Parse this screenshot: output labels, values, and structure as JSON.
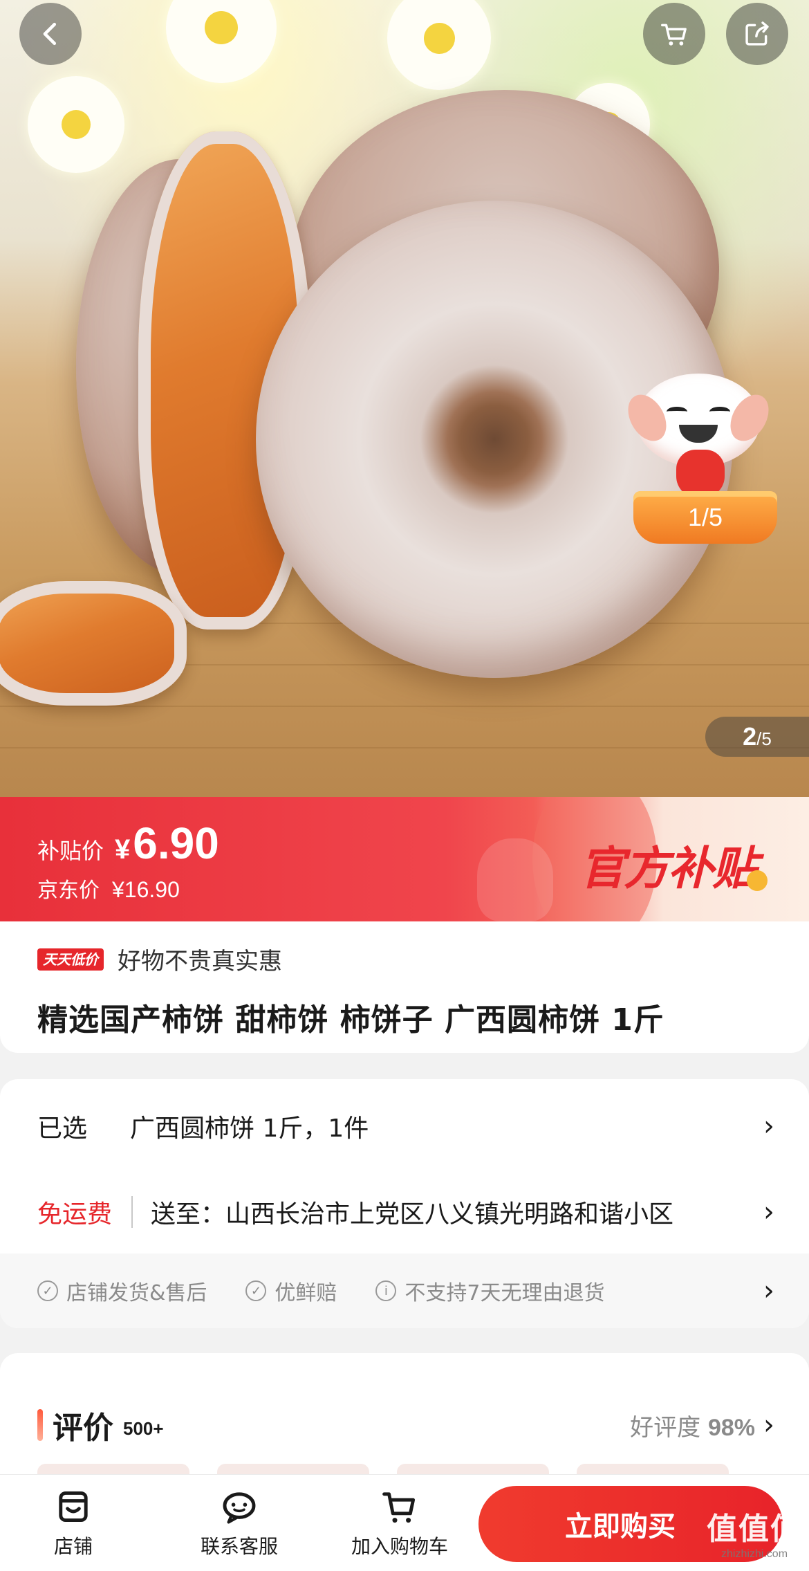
{
  "hero": {
    "pager_current": "2",
    "pager_total": "/5",
    "mascot_badge": "1/5"
  },
  "price": {
    "subsidy_label": "补贴价",
    "subsidy_currency": "¥",
    "subsidy_value": "6.90",
    "jd_label": "京东价",
    "jd_value": "¥16.90",
    "official_badge": "官方补贴"
  },
  "product": {
    "tag": "天天低价",
    "slogan": "好物不贵真实惠",
    "title": "精选国产柿饼 甜柿饼 柿饼子 广西圆柿饼 1斤"
  },
  "spec": {
    "selected_key": "已选",
    "selected_value": "广西圆柿饼 1斤，1件",
    "shipping_free": "免运费",
    "ship_to": "送至：山西长治市上党区八义镇光明路和谐小区",
    "chevron": "›"
  },
  "services": [
    {
      "icon": "check-circle-icon",
      "glyph": "✓",
      "label": "店铺发货&售后"
    },
    {
      "icon": "check-circle-icon",
      "glyph": "✓",
      "label": "优鲜赔"
    },
    {
      "icon": "info-circle-icon",
      "glyph": "i",
      "label": "不支持7天无理由退货"
    }
  ],
  "reviews": {
    "title": "评价",
    "count": "500+",
    "rate_label": "好评度",
    "rate_value": "98%"
  },
  "bottom_bar": {
    "shop": "店铺",
    "service": "联系客服",
    "add_cart": "加入购物车",
    "buy_now": "立即购买"
  },
  "watermark": {
    "big": "值值值",
    "small": "zhizhizhi.com"
  },
  "colors": {
    "brand_red": "#e6262b",
    "price_banner": "#f0454c",
    "muted_text": "#8a8a8a"
  }
}
